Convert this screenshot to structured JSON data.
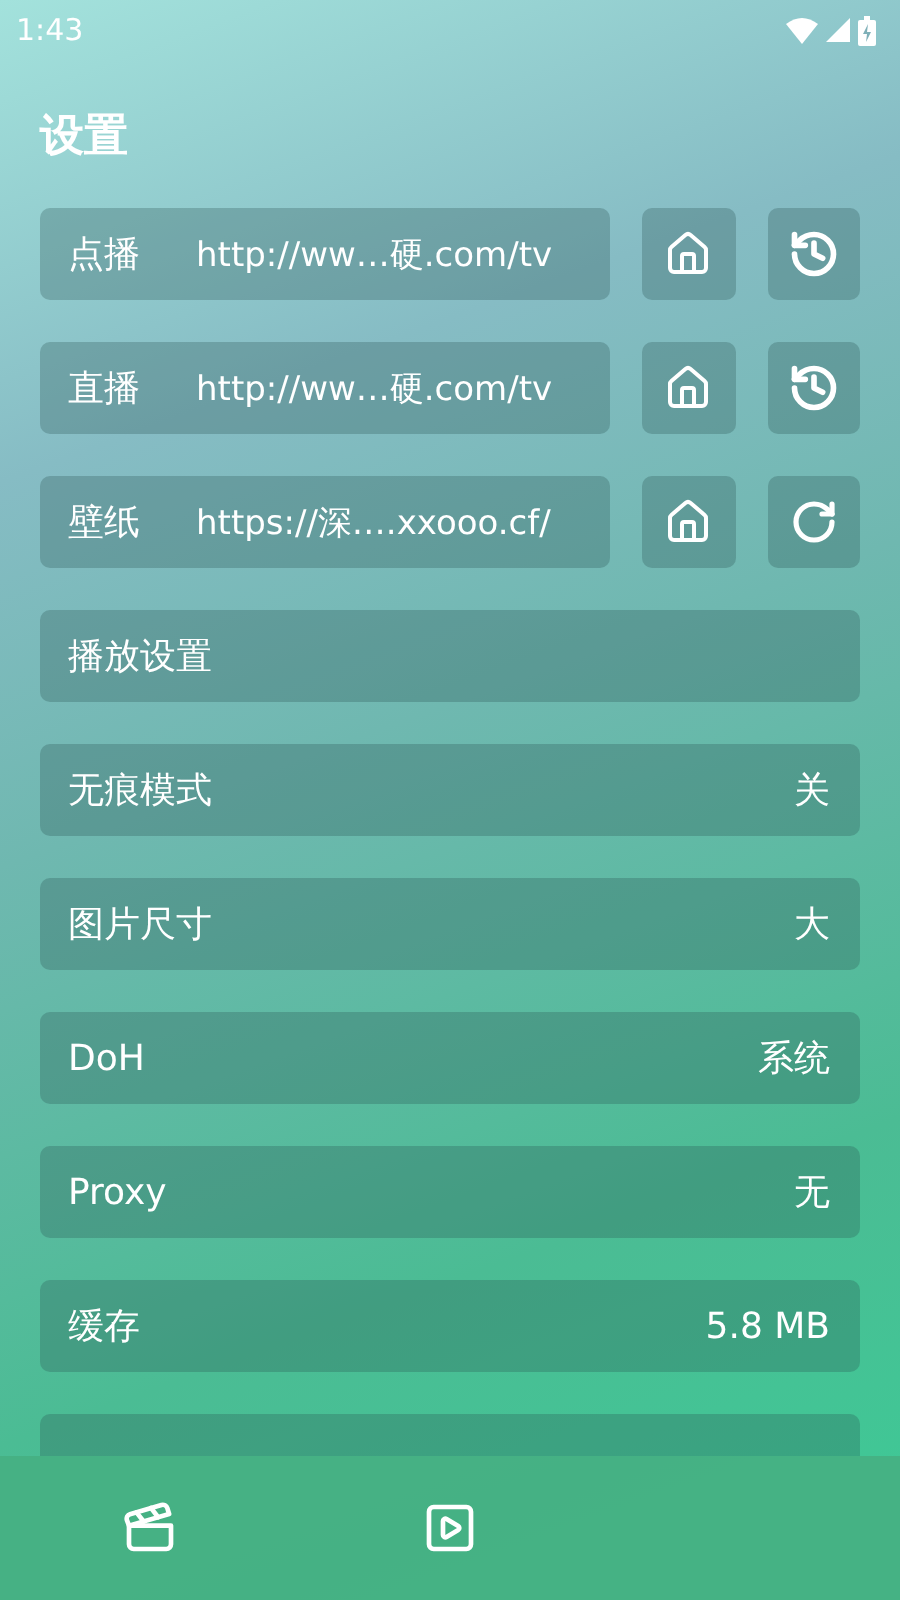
{
  "status_bar": {
    "time": "1:43"
  },
  "title": "设置",
  "sources": [
    {
      "label": "点播",
      "url": "http://ww…硬.com/tv",
      "actions": [
        {
          "kind": "home"
        },
        {
          "kind": "history"
        }
      ]
    },
    {
      "label": "直播",
      "url": "http://ww…硬.com/tv",
      "actions": [
        {
          "kind": "home"
        },
        {
          "kind": "history"
        }
      ]
    },
    {
      "label": "壁纸",
      "url": "https://深….xxooo.cf/",
      "actions": [
        {
          "kind": "home"
        },
        {
          "kind": "refresh"
        }
      ]
    }
  ],
  "settings": [
    {
      "kind": "row",
      "label": "播放设置"
    },
    {
      "kind": "row",
      "label": "无痕模式",
      "value": "关"
    },
    {
      "kind": "row",
      "label": "图片尺寸",
      "value": "大"
    },
    {
      "kind": "row",
      "label": "DoH",
      "value": "系统"
    },
    {
      "kind": "row",
      "label": "Proxy",
      "value": "无"
    },
    {
      "kind": "row",
      "label": "缓存",
      "value": "5.8 MB"
    },
    {
      "kind": "cut_off"
    }
  ],
  "nav": [
    {
      "kind": "clapper"
    },
    {
      "kind": "play"
    }
  ]
}
